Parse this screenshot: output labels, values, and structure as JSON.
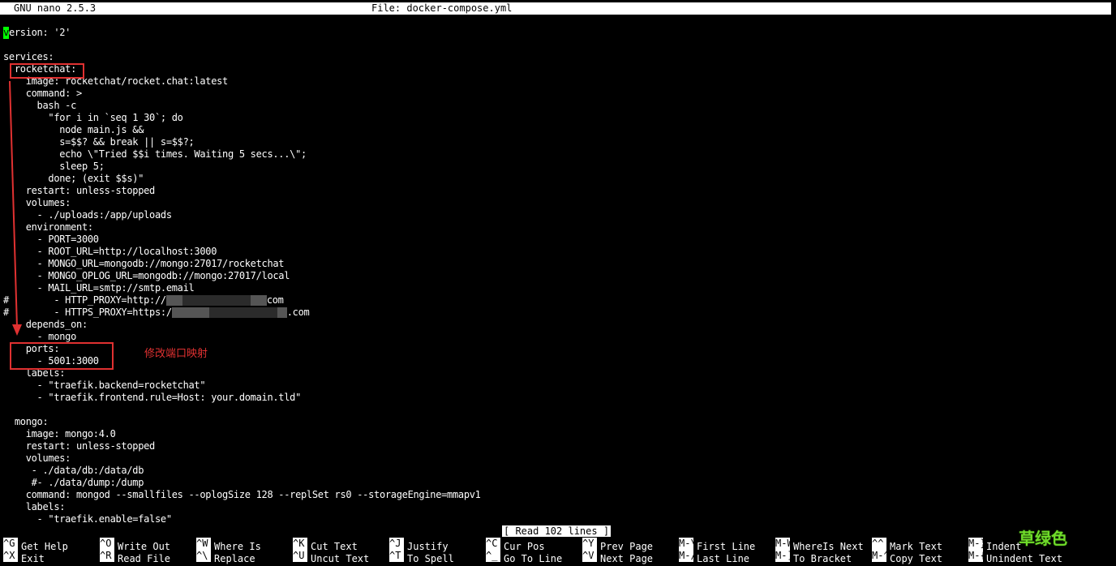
{
  "titlebar": {
    "app": "GNU nano 2.5.3",
    "file": "File: docker-compose.yml"
  },
  "editor": {
    "cursor_char": "v",
    "lines": [
      "ersion: '2'",
      "",
      "services:",
      "  rocketchat:",
      "    image: rocketchat/rocket.chat:latest",
      "    command: >",
      "      bash -c",
      "        \"for i in `seq 1 30`; do",
      "          node main.js &&",
      "          s=$$? && break || s=$$?;",
      "          echo \\\"Tried $$i times. Waiting 5 secs...\\\";",
      "          sleep 5;",
      "        done; (exit $$s)\"",
      "    restart: unless-stopped",
      "    volumes:",
      "      - ./uploads:/app/uploads",
      "    environment:",
      "      - PORT=3000",
      "      - ROOT_URL=http://localhost:3000",
      "      - MONGO_URL=mongodb://mongo:27017/rocketchat",
      "      - MONGO_OPLOG_URL=mongodb://mongo:27017/local",
      "      - MAIL_URL=smtp://smtp.email",
      "#        - HTTP_PROXY=http://",
      "#        - HTTPS_PROXY=https:/",
      "    depends_on:",
      "      - mongo",
      "    ports:",
      "      - 5001:3000",
      "    labels:",
      "      - \"traefik.backend=rocketchat\"",
      "      - \"traefik.frontend.rule=Host: your.domain.tld\"",
      "",
      "  mongo:",
      "    image: mongo:4.0",
      "    restart: unless-stopped",
      "    volumes:",
      "     - ./data/db:/data/db",
      "     #- ./data/dump:/dump",
      "    command: mongod --smallfiles --oplogSize 128 --replSet rs0 --storageEngine=mmapv1",
      "    labels:",
      "      - \"traefik.enable=false\""
    ],
    "proxy_suffix": "com",
    "proxy_suffix_2": ".com"
  },
  "annotation": {
    "note": "修改端口映射",
    "color": "#e03131"
  },
  "status": "[ Read 102 lines ]",
  "shortcuts": [
    {
      "key": "^G",
      "label": "Get Help"
    },
    {
      "key": "^O",
      "label": "Write Out"
    },
    {
      "key": "^W",
      "label": "Where Is"
    },
    {
      "key": "^K",
      "label": "Cut Text"
    },
    {
      "key": "^J",
      "label": "Justify"
    },
    {
      "key": "^C",
      "label": "Cur Pos"
    },
    {
      "key": "^Y",
      "label": "Prev Page"
    },
    {
      "key": "M-\\",
      "label": "First Line"
    },
    {
      "key": "M-W",
      "label": "WhereIs Next"
    },
    {
      "key": "^^",
      "label": "Mark Text"
    },
    {
      "key": "M-}",
      "label": "Indent"
    },
    {
      "key": "^X",
      "label": "Exit"
    },
    {
      "key": "^R",
      "label": "Read File"
    },
    {
      "key": "^\\",
      "label": "Replace"
    },
    {
      "key": "^U",
      "label": "Uncut Text"
    },
    {
      "key": "^T",
      "label": "To Spell"
    },
    {
      "key": "^_",
      "label": "Go To Line"
    },
    {
      "key": "^V",
      "label": "Next Page"
    },
    {
      "key": "M-/",
      "label": "Last Line"
    },
    {
      "key": "M-]",
      "label": "To Bracket"
    },
    {
      "key": "M-^",
      "label": "Copy Text"
    },
    {
      "key": "M-{",
      "label": "Unindent Text"
    }
  ],
  "watermark": "草绿色",
  "colors": {
    "background": "#000000",
    "foreground": "#ffffff",
    "cursor": "#00ff00",
    "watermark": "#6fdc2a"
  }
}
